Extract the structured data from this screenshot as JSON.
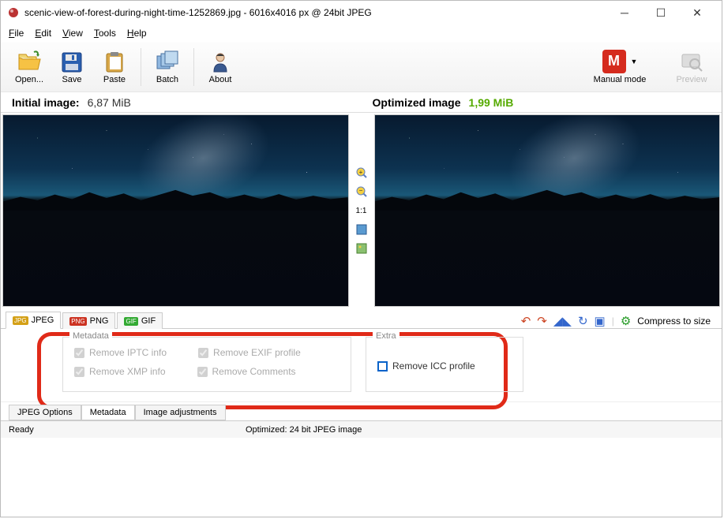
{
  "window": {
    "title": "scenic-view-of-forest-during-night-time-1252869.jpg - 6016x4016 px @ 24bit JPEG"
  },
  "menu": {
    "file": "File",
    "edit": "Edit",
    "view": "View",
    "tools": "Tools",
    "help": "Help"
  },
  "toolbar": {
    "open": "Open...",
    "save": "Save",
    "paste": "Paste",
    "batch": "Batch",
    "about": "About",
    "manual": "Manual mode",
    "manual_badge": "M",
    "preview": "Preview"
  },
  "sizes": {
    "initial_lbl": "Initial image:",
    "initial_val": "6,87 MiB",
    "optimized_lbl": "Optimized image",
    "optimized_val": "1,99 MiB"
  },
  "mid": {
    "ratio": "1:1"
  },
  "format_tabs": {
    "jpeg": "JPEG",
    "png": "PNG",
    "gif": "GIF"
  },
  "compress": "Compress to size",
  "metadata": {
    "legend": "Metadata",
    "iptc": "Remove IPTC info",
    "exif": "Remove EXIF profile",
    "xmp": "Remove XMP info",
    "comments": "Remove Comments"
  },
  "extra": {
    "legend": "Extra",
    "icc": "Remove ICC profile"
  },
  "tabs": {
    "jpeg_opts": "JPEG Options",
    "metadata": "Metadata",
    "image_adj": "Image adjustments"
  },
  "status": {
    "ready": "Ready",
    "optimized": "Optimized: 24 bit JPEG image"
  }
}
